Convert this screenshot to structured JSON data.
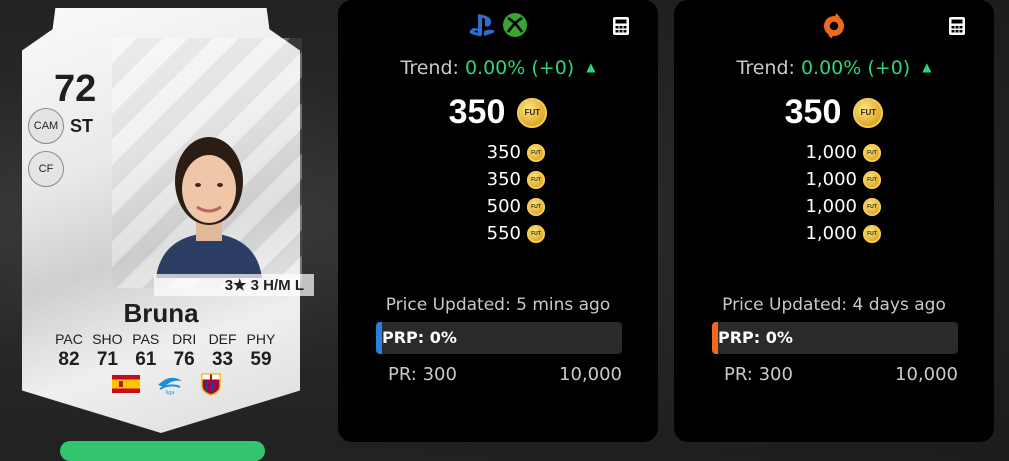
{
  "player_card": {
    "rating": "72",
    "position": "ST",
    "alt_positions": [
      "CAM",
      "CF"
    ],
    "skills_workrates": "3★ 3 H/M L",
    "name": "Bruna",
    "stats": [
      {
        "label": "PAC",
        "value": "82"
      },
      {
        "label": "SHO",
        "value": "71"
      },
      {
        "label": "PAS",
        "value": "61"
      },
      {
        "label": "DRI",
        "value": "76"
      },
      {
        "label": "DEF",
        "value": "33"
      },
      {
        "label": "PHY",
        "value": "59"
      }
    ],
    "badges": [
      "spain-flag-icon",
      "league-logo-icon",
      "club-crest-icon"
    ]
  },
  "panels": [
    {
      "platform_icons": [
        "playstation-icon",
        "xbox-icon"
      ],
      "trend_label": "Trend:",
      "trend_value": "0.00% (+0)",
      "main_price": "350",
      "prices": [
        "350",
        "350",
        "500",
        "550"
      ],
      "updated": "Price Updated: 5 mins ago",
      "prp": "PRP: 0%",
      "accent": "#2b7fe0",
      "pr_min": "PR: 300",
      "pr_max": "10,000"
    },
    {
      "platform_icons": [
        "origin-icon"
      ],
      "trend_label": "Trend:",
      "trend_value": "0.00% (+0)",
      "main_price": "350",
      "prices": [
        "1,000",
        "1,000",
        "1,000",
        "1,000"
      ],
      "updated": "Price Updated: 4 days ago",
      "prp": "PRP: 0%",
      "accent": "#f06a1e",
      "pr_min": "PR: 300",
      "pr_max": "10,000"
    }
  ],
  "coin_label": "FUT",
  "colors": {
    "trend": "#2ed47a",
    "coin": "#d9a21c",
    "cta": "#33c46f"
  }
}
